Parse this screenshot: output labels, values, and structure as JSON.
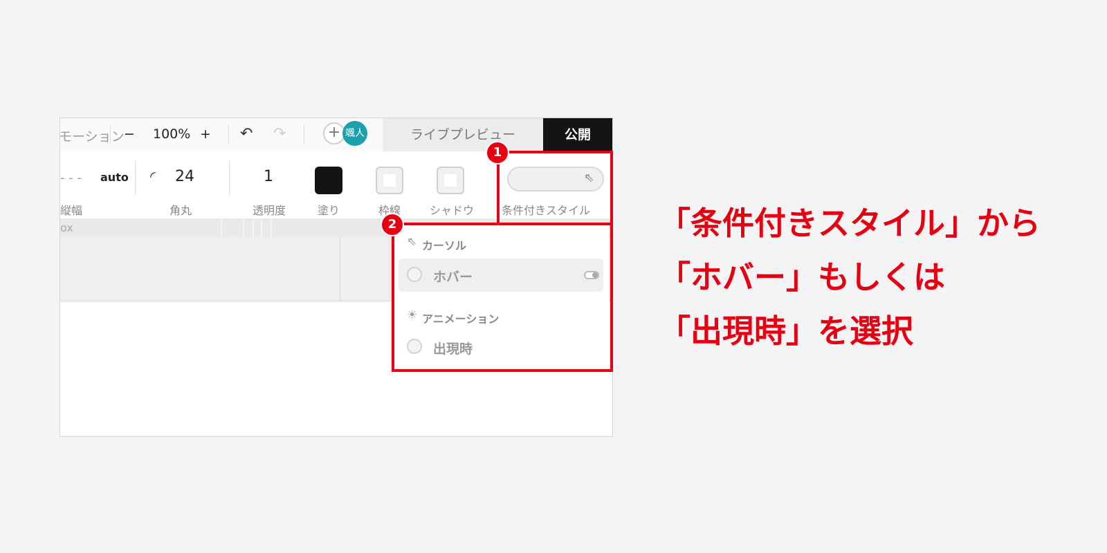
{
  "toolbar": {
    "motion_label": "モーション",
    "zoom_minus": "−",
    "zoom_level": "100%",
    "zoom_plus": "+",
    "undo_icon": "undo-icon",
    "redo_icon": "redo-icon",
    "avatar_text": "颯人",
    "live_preview": "ライブプレビュー",
    "publish": "公開"
  },
  "properties": {
    "height_dash": "- - -",
    "height_value": "auto",
    "height_label": "縦幅",
    "radius_value": "24",
    "radius_label": "角丸",
    "opacity_value": "1",
    "opacity_label": "透明度",
    "fill_label": "塗り",
    "border_label": "枠線",
    "shadow_label": "シャドウ",
    "conditional_label": "条件付きスタイル"
  },
  "canvas": {
    "label": "ox"
  },
  "dropdown": {
    "cursor_header": "カーソル",
    "hover_item": "ホバー",
    "animation_header": "アニメーション",
    "appear_item": "出現時"
  },
  "badges": {
    "one": "1",
    "two": "2"
  },
  "instruction": {
    "line1": "「条件付きスタイル」から",
    "line2": "「ホバー」もしくは",
    "line3": "「出現時」を選択"
  },
  "colors": {
    "highlight": "#e60012",
    "publish_bg": "#141414",
    "avatar": "#1ba0ad"
  }
}
